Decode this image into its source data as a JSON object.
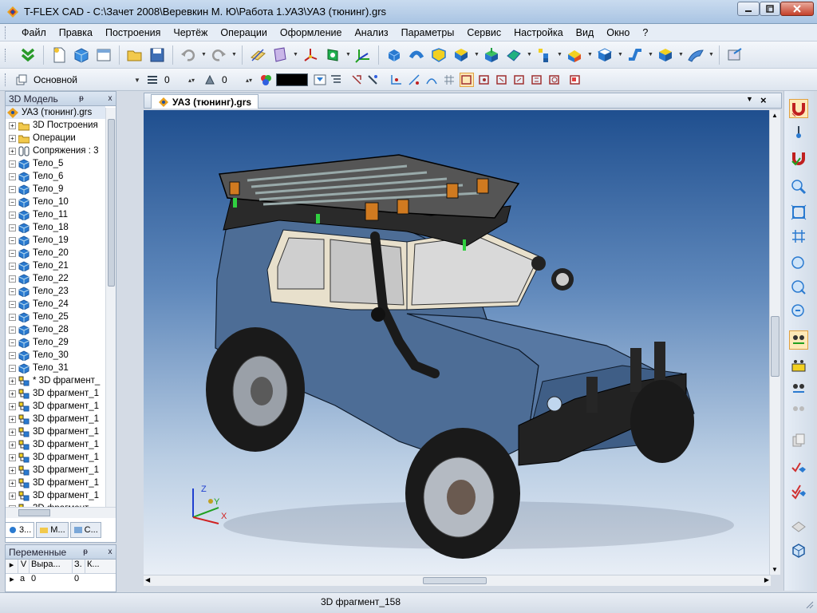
{
  "window": {
    "title": "T-FLEX CAD - C:\\Зачет 2008\\Веревкин М. Ю\\Работа 1.УАЗ\\УАЗ (тюнинг).grs"
  },
  "menu": [
    "Файл",
    "Правка",
    "Построения",
    "Чертёж",
    "Операции",
    "Оформление",
    "Анализ",
    "Параметры",
    "Сервис",
    "Настройка",
    "Вид",
    "Окно",
    "?"
  ],
  "toolbar2": {
    "layer_value": "Основной",
    "level_value": "0",
    "priority_value": "0",
    "color_value": "#000000"
  },
  "tree_panel": {
    "title": "3D Модель",
    "pin": "ᵽ",
    "close": "x",
    "items": [
      {
        "label": "УАЗ (тюнинг).grs",
        "type": "root"
      },
      {
        "label": "3D Построения",
        "type": "folder"
      },
      {
        "label": "Операции",
        "type": "folder"
      },
      {
        "label": "Сопряжения : 3",
        "type": "mate"
      },
      {
        "label": "Тело_5",
        "type": "body"
      },
      {
        "label": "Тело_6",
        "type": "body"
      },
      {
        "label": "Тело_9",
        "type": "body"
      },
      {
        "label": "Тело_10",
        "type": "body"
      },
      {
        "label": "Тело_11",
        "type": "body"
      },
      {
        "label": "Тело_18",
        "type": "body"
      },
      {
        "label": "Тело_19",
        "type": "body"
      },
      {
        "label": "Тело_20",
        "type": "body"
      },
      {
        "label": "Тело_21",
        "type": "body"
      },
      {
        "label": "Тело_22",
        "type": "body"
      },
      {
        "label": "Тело_23",
        "type": "body"
      },
      {
        "label": "Тело_24",
        "type": "body"
      },
      {
        "label": "Тело_25",
        "type": "body"
      },
      {
        "label": "Тело_28",
        "type": "body"
      },
      {
        "label": "Тело_29",
        "type": "body"
      },
      {
        "label": "Тело_30",
        "type": "body"
      },
      {
        "label": "Тело_31",
        "type": "body"
      },
      {
        "label": "* 3D фрагмент_",
        "type": "fragment"
      },
      {
        "label": "3D фрагмент_1",
        "type": "fragment"
      },
      {
        "label": "3D фрагмент_1",
        "type": "fragment"
      },
      {
        "label": "3D фрагмент_1",
        "type": "fragment"
      },
      {
        "label": "3D фрагмент_1",
        "type": "fragment"
      },
      {
        "label": "3D фрагмент_1",
        "type": "fragment"
      },
      {
        "label": "3D фрагмент_1",
        "type": "fragment"
      },
      {
        "label": "3D фрагмент_1",
        "type": "fragment"
      },
      {
        "label": "3D фрагмент_1",
        "type": "fragment"
      },
      {
        "label": "3D фрагмент_1",
        "type": "fragment"
      },
      {
        "label": "3D фрагмент",
        "type": "fragment"
      }
    ],
    "tabs": [
      "3...",
      "M...",
      "C..."
    ]
  },
  "vars_panel": {
    "title": "Переменные",
    "columns": [
      "V",
      "Выра...",
      "З.",
      "К..."
    ],
    "rows": [
      {
        "name": "a",
        "expr": "0",
        "value": "0"
      }
    ]
  },
  "document": {
    "tab_label": "УАЗ (тюнинг).grs"
  },
  "axes": {
    "x": "X",
    "y": "Y",
    "z": "Z"
  },
  "status": {
    "text": "3D фрагмент_158"
  },
  "colors": {
    "car_body": "#4d6d96",
    "roof": "#2a2a2a",
    "tire": "#1a1a1a",
    "viewport_top": "#1f4f8f",
    "viewport_bottom": "#e8eef6"
  }
}
